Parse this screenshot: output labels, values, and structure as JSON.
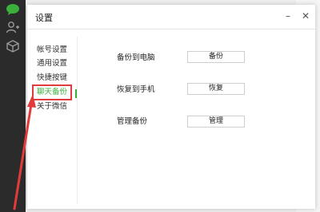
{
  "dialog": {
    "title": "设置",
    "minimize_glyph": "–",
    "close_glyph": "✕"
  },
  "nav": {
    "items": [
      {
        "label": "帐号设置"
      },
      {
        "label": "通用设置"
      },
      {
        "label": "快捷按键"
      },
      {
        "label": "聊天备份"
      },
      {
        "label": "关于微信"
      }
    ],
    "active_index": 3
  },
  "backup": {
    "rows": [
      {
        "label": "备份到电脑",
        "button": "备份"
      },
      {
        "label": "恢复到手机",
        "button": "恢复"
      },
      {
        "label": "管理备份",
        "button": "管理"
      }
    ]
  },
  "colors": {
    "accent": "#3bb03b",
    "highlight": "#e33b3b",
    "rail": "#2b2b2c"
  },
  "icons": {
    "rail": [
      "chat-icon",
      "contacts-icon",
      "favorites-icon"
    ]
  }
}
